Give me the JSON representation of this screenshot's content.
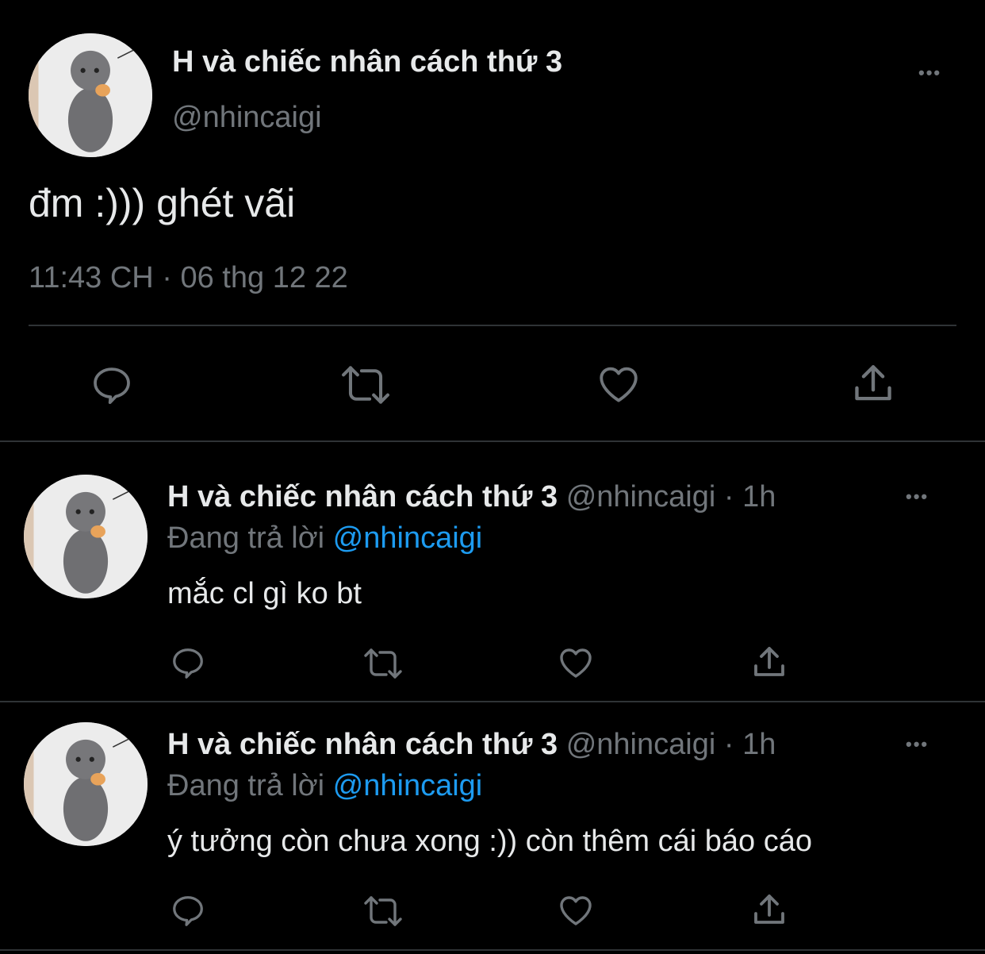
{
  "main_tweet": {
    "display_name": "H và chiếc nhân cách thứ 3",
    "handle": "@nhincaigi",
    "text": "đm :))) ghét vãi",
    "timestamp": "11:43 CH · 06 thg 12 22",
    "more_label": "•••"
  },
  "replies": [
    {
      "display_name": "H và chiếc nhân cách thứ 3",
      "handle": "@nhincaigi",
      "sep": "·",
      "time": "1h",
      "reply_prefix": "Đang trả lời",
      "reply_to": "@nhincaigi",
      "text": "mắc cl gì ko bt",
      "more_label": "•••"
    },
    {
      "display_name": "H và chiếc nhân cách thứ 3",
      "handle": "@nhincaigi",
      "sep": "·",
      "time": "1h",
      "reply_prefix": "Đang trả lời",
      "reply_to": "@nhincaigi",
      "text": "ý tưởng còn chưa xong :)) còn thêm cái báo cáo",
      "more_label": "•••"
    }
  ],
  "colors": {
    "background": "#000000",
    "text_primary": "#e7e9ea",
    "text_muted": "#71767b",
    "link": "#1d9bf0",
    "divider": "#2f3336"
  },
  "icons": [
    "reply-icon",
    "retweet-icon",
    "like-icon",
    "share-icon",
    "more-icon",
    "avatar"
  ]
}
